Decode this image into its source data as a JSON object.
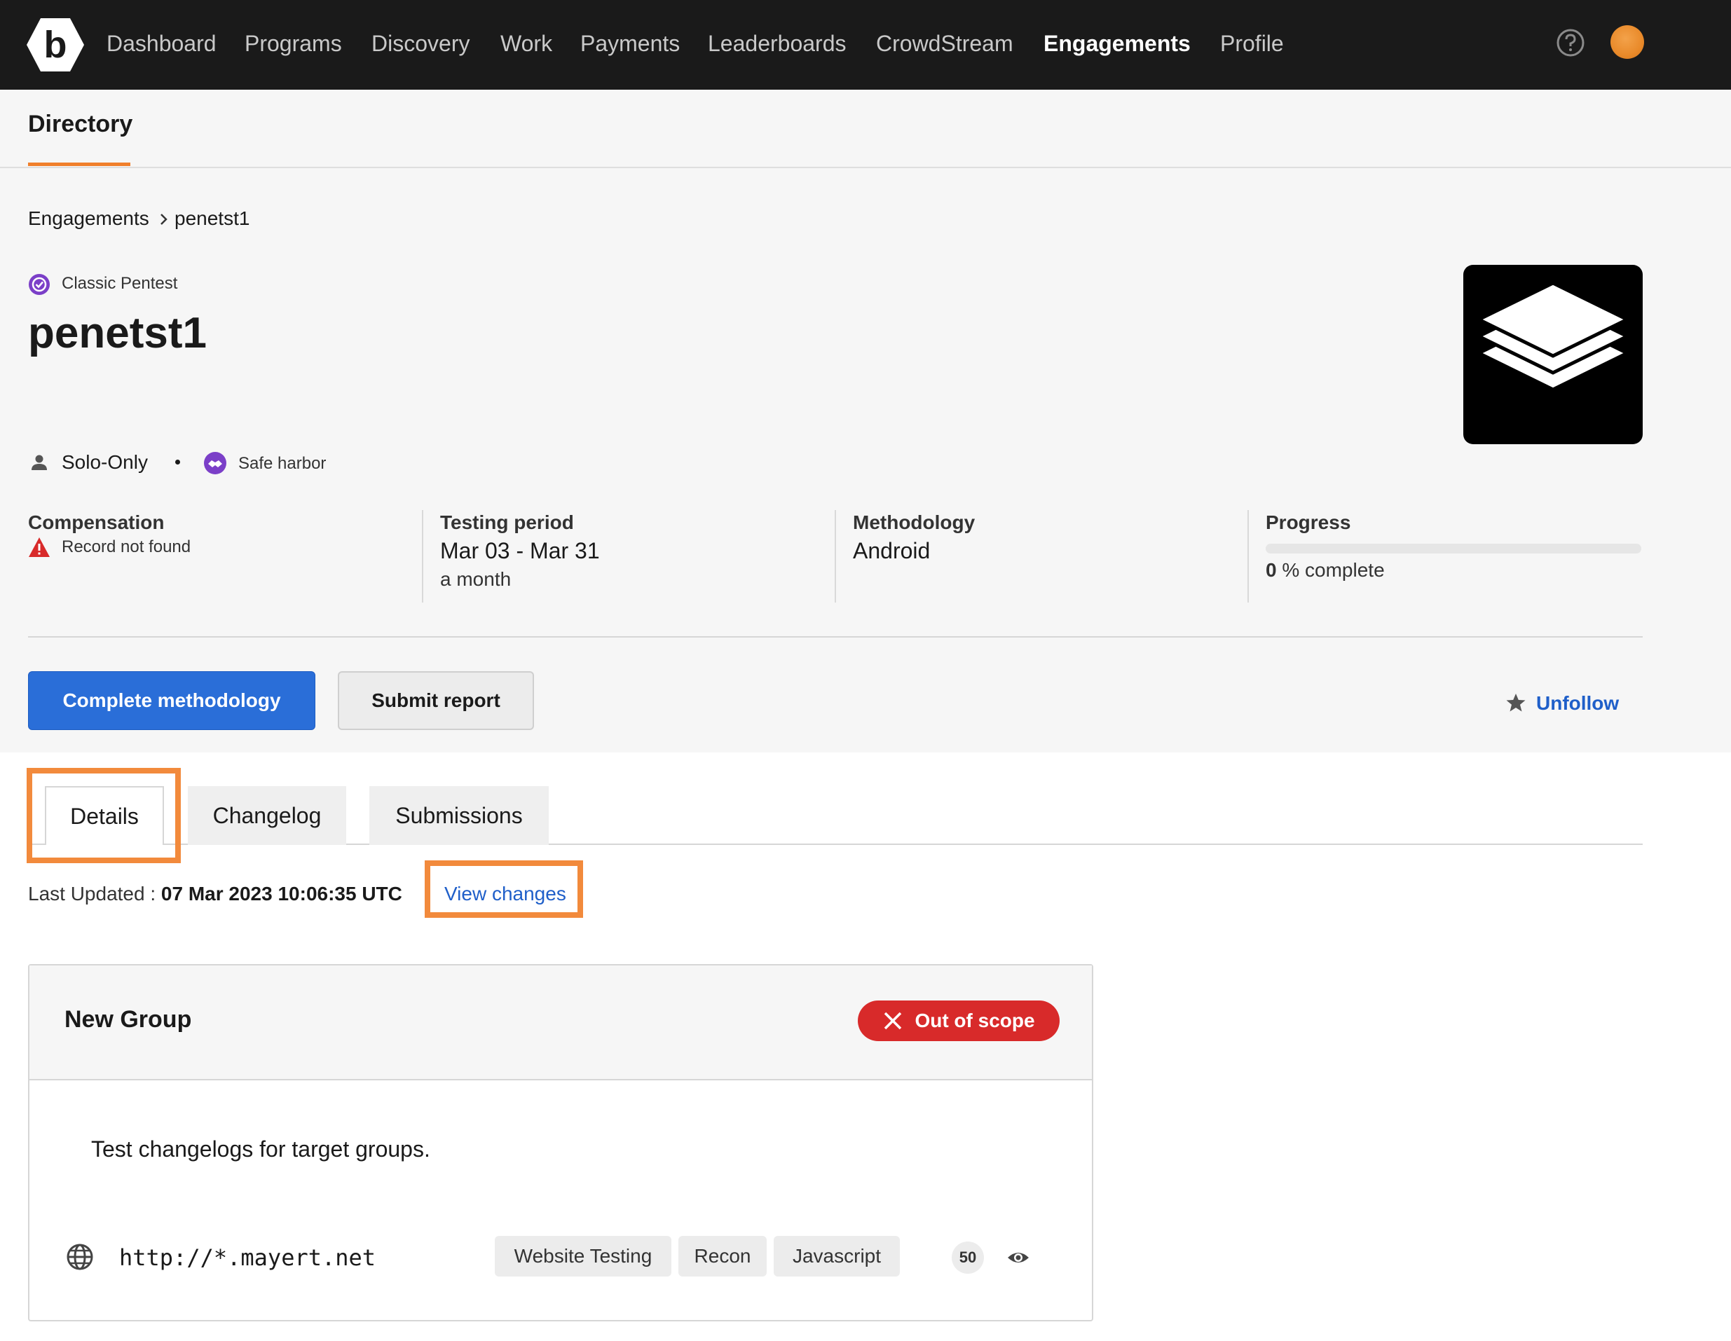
{
  "topnav": {
    "items": [
      "Dashboard",
      "Programs",
      "Discovery",
      "Work",
      "Payments",
      "Leaderboards",
      "CrowdStream",
      "Engagements",
      "Profile"
    ],
    "active": "Engagements",
    "logo_letter": "b"
  },
  "subnav": {
    "label": "Directory"
  },
  "breadcrumb": {
    "root": "Engagements",
    "current": "penetst1"
  },
  "engagement": {
    "type": "Classic Pentest",
    "title": "penetst1",
    "team": "Solo-Only",
    "safe_harbor": "Safe harbor"
  },
  "stats": {
    "compensation": {
      "label": "Compensation",
      "value": "Record not found"
    },
    "testing_period": {
      "label": "Testing period",
      "value": "Mar 03 - Mar 31",
      "sub": "a month"
    },
    "methodology": {
      "label": "Methodology",
      "value": "Android"
    },
    "progress": {
      "label": "Progress",
      "value": "0",
      "suffix": "% complete",
      "percent": 0
    }
  },
  "actions": {
    "primary": "Complete methodology",
    "secondary": "Submit report",
    "follow": "Unfollow"
  },
  "tabs": [
    "Details",
    "Changelog",
    "Submissions"
  ],
  "active_tab": "Details",
  "last_updated": {
    "label": "Last Updated :",
    "value": "07 Mar 2023 10:06:35 UTC",
    "link": "View changes"
  },
  "group": {
    "title": "New Group",
    "scope": "Out of scope",
    "description": "Test changelogs for target groups.",
    "target": {
      "url": "http://*.mayert.net",
      "tags": [
        "Website Testing",
        "Recon",
        "Javascript"
      ],
      "count": "50"
    }
  },
  "colors": {
    "accent_orange": "#f07f2b",
    "primary_blue": "#2a6ed8",
    "danger_red": "#d82a2a",
    "nav_bg": "#1a1a1a"
  }
}
